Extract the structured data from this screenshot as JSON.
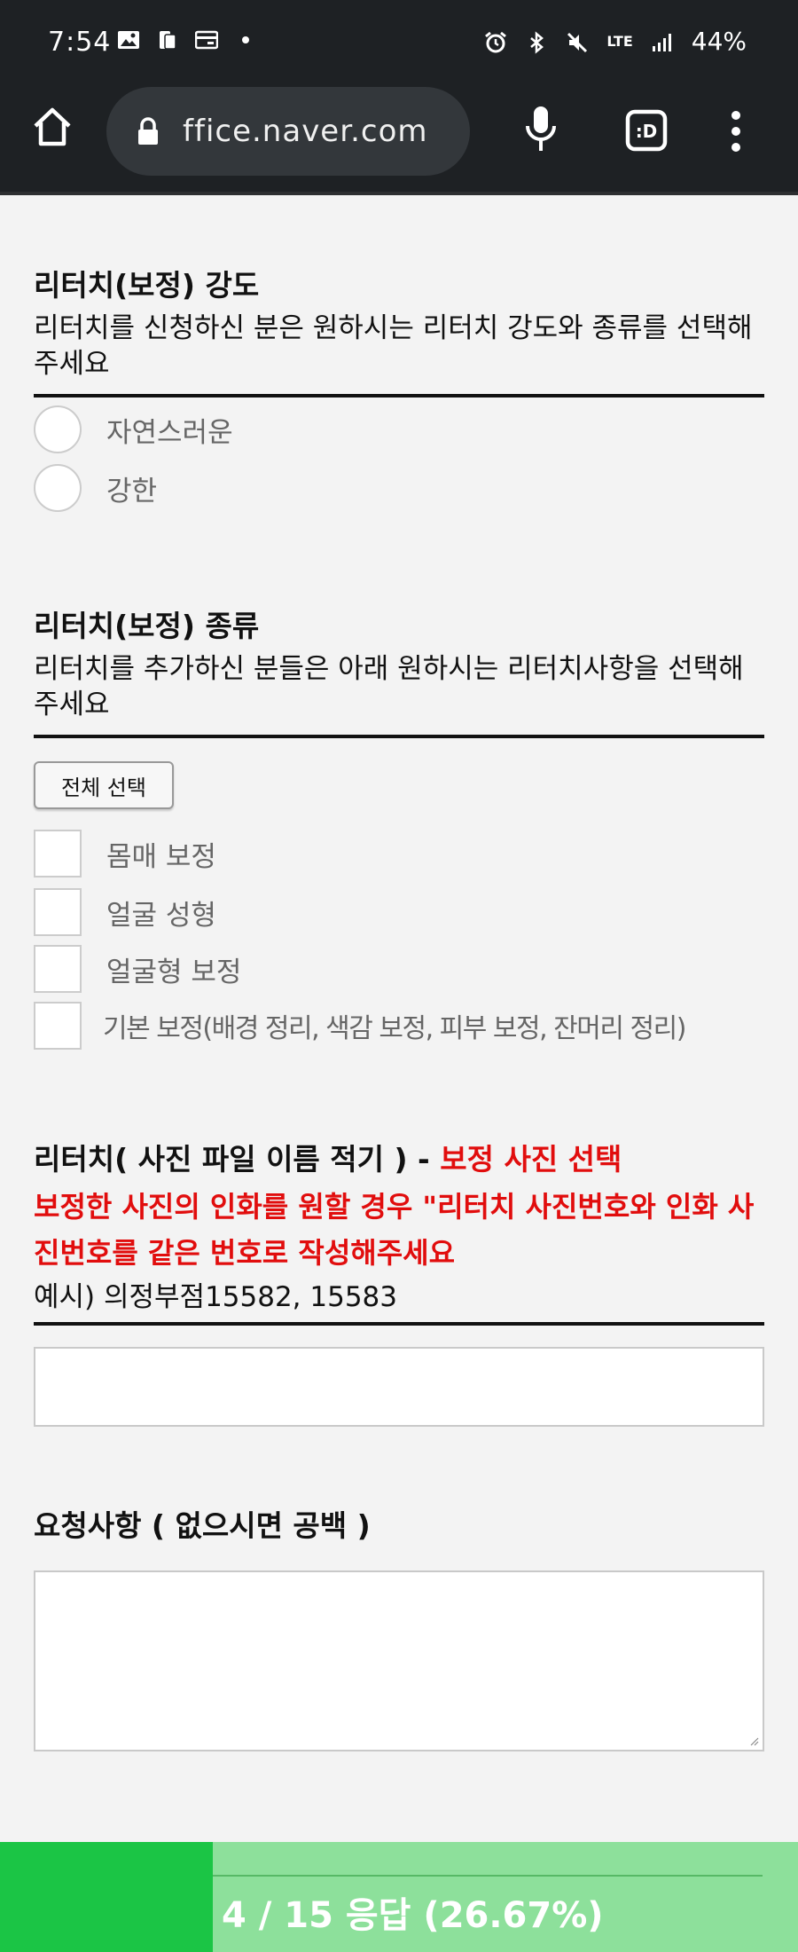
{
  "status_bar": {
    "time": "7:54",
    "battery": "44%",
    "network": "LTE"
  },
  "browser": {
    "url": "ffice.naver.com"
  },
  "sections": {
    "retouch_strength": {
      "title": "리터치(보정) 강도",
      "description": "리터치를 신청하신 분은 원하시는 리터치 강도와 종류를 선택해주세요",
      "options": [
        "자연스러운",
        "강한"
      ]
    },
    "retouch_type": {
      "title": "리터치(보정) 종류",
      "description": "리터치를 추가하신 분들은 아래 원하시는 리터치사항을 선택해주세요",
      "select_all_label": "전체 선택",
      "options": [
        "몸매 보정",
        "얼굴 성형",
        "얼굴형 보정",
        "기본 보정(배경 정리, 색감 보정, 피부 보정, 잔머리 정리)"
      ]
    },
    "retouch_photo": {
      "title_prefix": "리터치( 사진 파일 이름 적기 ) - ",
      "title_highlight": "보정 사진 선택",
      "notice": "보정한 사진의 인화를 원할 경우 \"리터치 사진번호와 인화 사진번호를 같은 번호로 작성해주세요",
      "example": "예시) 의정부점15582, 15583",
      "input_value": ""
    },
    "requests": {
      "title": "요청사항 ( 없으시면 공백 )",
      "input_value": ""
    }
  },
  "progress": {
    "label": "4 / 15 응답 (26.67%)",
    "fraction": 0.2667
  },
  "colors": {
    "chrome_bg": "#1e2124",
    "accent_red": "#e10d0d",
    "progress_fill": "#1bc545",
    "progress_track": "#8de09b"
  }
}
